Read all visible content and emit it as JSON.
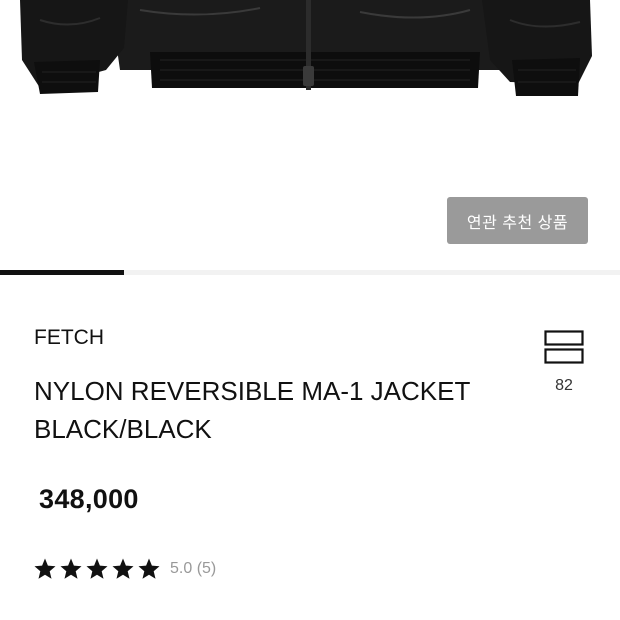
{
  "product": {
    "brand": "FETCH",
    "name_line1": "NYLON REVERSIBLE MA-1 JACKET",
    "name_line2": "BLACK/BLACK",
    "price": "348,000",
    "rating": {
      "stars": 5,
      "score_text": "5.0 (5)"
    }
  },
  "hero": {
    "related_button_label": "연관 추천 상품",
    "image_icon": "black-bomber-jacket-photo"
  },
  "like": {
    "icon": "like-stack-icon",
    "count": "82"
  },
  "tabs": {
    "active_index": 0
  },
  "colors": {
    "button_bg": "#9a9a9a",
    "text": "#111111",
    "muted": "#999999"
  }
}
